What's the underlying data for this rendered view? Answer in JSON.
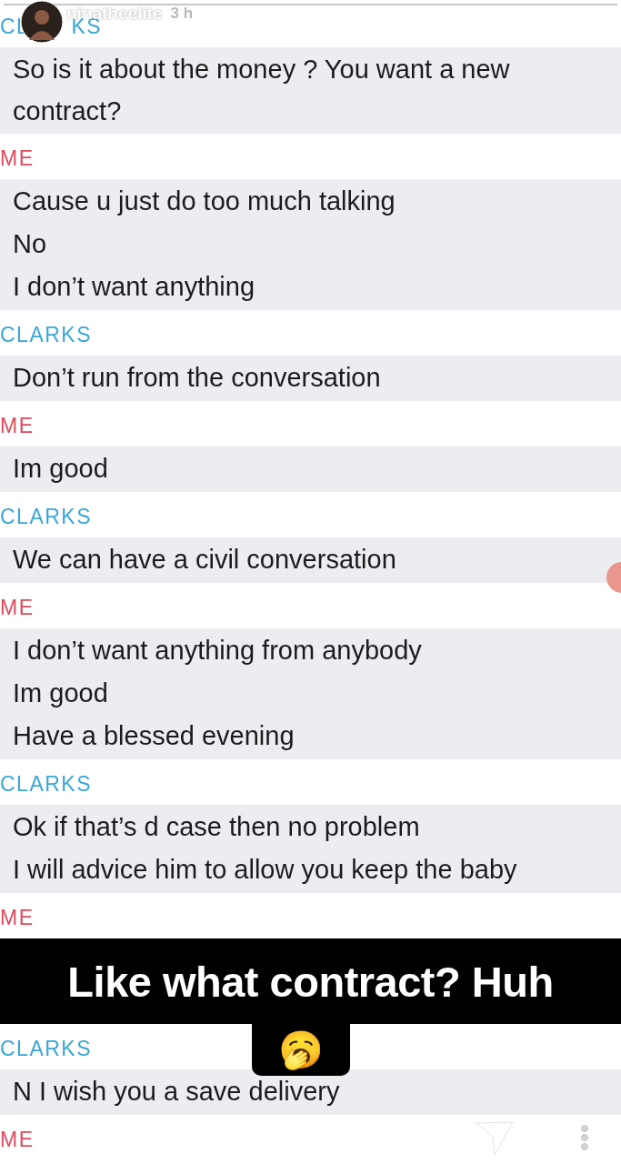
{
  "story": {
    "username": "ninatheelite",
    "time": "3 h"
  },
  "chat": [
    {
      "color": "#3aa6d6",
      "sender_parts": [
        "CL",
        "KS"
      ],
      "messages": [
        "So is it about the money ? You want a new contract?"
      ]
    },
    {
      "color": "#dc4a5c",
      "sender_parts": [
        "ME"
      ],
      "messages": [
        "Cause u just do too much talking",
        "No",
        "I don’t want anything"
      ]
    },
    {
      "color": "#3aa6d6",
      "sender_parts": [
        "CLARKS"
      ],
      "messages": [
        "Don’t run from the conversation"
      ]
    },
    {
      "color": "#dc4a5c",
      "sender_parts": [
        "ME"
      ],
      "messages": [
        "Im good"
      ]
    },
    {
      "color": "#3aa6d6",
      "sender_parts": [
        "CLARKS"
      ],
      "messages": [
        "We can have a civil conversation"
      ]
    },
    {
      "color": "#dc4a5c",
      "sender_parts": [
        "ME"
      ],
      "messages": [
        "I don’t want anything from anybody",
        "Im good",
        "Have a blessed evening"
      ]
    },
    {
      "color": "#3aa6d6",
      "sender_parts": [
        "CLARKS"
      ],
      "messages": [
        "Ok if that’s d case then no problem",
        "I will advice him to allow you keep the baby"
      ]
    },
    {
      "color": "#dc4a5c",
      "sender_parts": [
        "ME"
      ]
    }
  ],
  "caption": {
    "text": "Like what contract? Huh",
    "emoji": "🥱"
  },
  "chat_continued": [
    {
      "color": "#3aa6d6",
      "sender_parts": [
        "CLARKS"
      ],
      "messages": [
        "N I wish you a save delivery"
      ]
    },
    {
      "color": "#dc4a5c",
      "sender_parts": [
        "ME"
      ]
    }
  ]
}
